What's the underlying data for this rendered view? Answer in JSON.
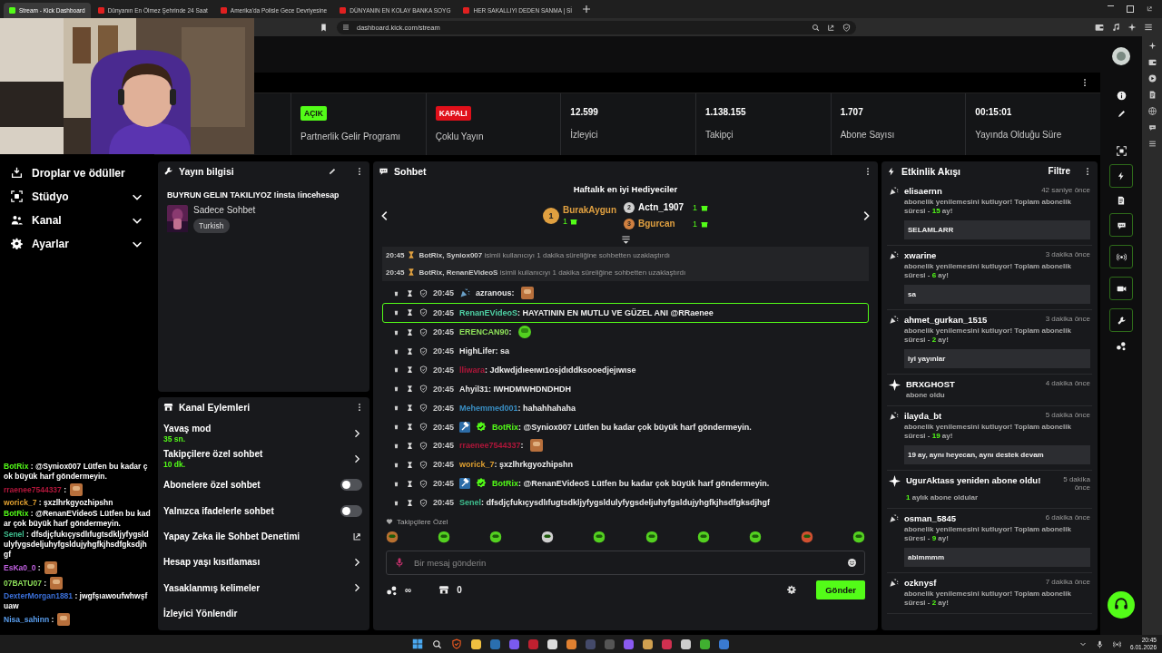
{
  "browser": {
    "tabs": [
      {
        "title": "Stream - Kick Dashboard",
        "selected": true
      },
      {
        "title": "Dünyanın En Ölmez Şehrinde 24 Saat",
        "selected": false
      },
      {
        "title": "Amerika'da Polisle Gece Devriyesine",
        "selected": false
      },
      {
        "title": "DÜNYANIN EN KOLAY BANKA SOYG",
        "selected": false
      },
      {
        "title": "HER SAKALLIYI DEDEN SANMA | Sİ",
        "selected": false
      }
    ],
    "address": "dashboard.kick.com/stream"
  },
  "stats": [
    {
      "kind": "status",
      "value": "AÇIK",
      "on": true,
      "label": "Partnerlik Gelir Programı"
    },
    {
      "kind": "status",
      "value": "KAPALI",
      "on": false,
      "label": "Çoklu Yayın"
    },
    {
      "kind": "number",
      "value": "12.599",
      "label": "İzleyici"
    },
    {
      "kind": "number",
      "value": "1.138.155",
      "label": "Takipçi"
    },
    {
      "kind": "number",
      "value": "1.707",
      "label": "Abone Sayısı"
    },
    {
      "kind": "number",
      "value": "00:15:01",
      "label": "Yayında Olduğu Süre"
    }
  ],
  "sidebar": {
    "items": [
      {
        "label": "Droplar ve ödüller",
        "kind": "link"
      },
      {
        "label": "Stüdyo",
        "kind": "group",
        "expanded": false
      },
      {
        "label": "Kanal",
        "kind": "group",
        "expanded": false
      },
      {
        "label": "Ayarlar",
        "kind": "group",
        "expanded": false
      }
    ]
  },
  "stream_info": {
    "title": "Yayın bilgisi",
    "stream_title": "BUYRUN GELIN TAKILIYOZ !insta !incehesap",
    "category": "Sadece Sohbet",
    "tag": "Turkish"
  },
  "channel_actions": {
    "title": "Kanal Eylemleri",
    "rows": [
      {
        "label": "Yavaş mod",
        "value": "35 sn.",
        "kind": "arrow"
      },
      {
        "label": "Takipçilere özel sohbet",
        "value": "10 dk.",
        "kind": "arrow"
      },
      {
        "label": "Abonelere özel sohbet",
        "kind": "toggle",
        "on": false
      },
      {
        "label": "Yalnızca ifadelerle sohbet",
        "kind": "toggle",
        "on": false
      },
      {
        "label": "Yapay Zeka ile Sohbet Denetimi",
        "kind": "external"
      },
      {
        "label": "Hesap yaşı kısıtlaması",
        "kind": "arrow"
      },
      {
        "label": "Yasaklanmış kelimeler",
        "kind": "arrow"
      },
      {
        "label": "İzleyici Yönlendir",
        "kind": "plain"
      }
    ]
  },
  "chat": {
    "title": "Sohbet",
    "gifters_title": "Haftalık en iyi Hediyeciler",
    "gifters": [
      {
        "rank": "1",
        "name": "BurakAygun",
        "count": "1"
      },
      {
        "rank": "2",
        "name": "Actn_1907",
        "count": "1"
      },
      {
        "rank": "3",
        "name": "Bgurcan",
        "count": "1"
      }
    ],
    "system": [
      {
        "time": "20:45",
        "actor": "BotRix, Syniox007",
        "text": "isimli kullanıcıyı 1 dakika süreliğine sohbetten uzaklaştırdı"
      },
      {
        "time": "20:45",
        "actor": "BotRix, RenanEVideoS",
        "text": "isimli kullanıcıyı 1 dakika süreliğine sohbetten uzaklaştırdı"
      }
    ],
    "messages": [
      {
        "time": "20:45",
        "user": "azranous",
        "color": "#e8e8e8",
        "kind": "badged",
        "text": ":",
        "emote": true,
        "highlighted": false
      },
      {
        "time": "20:45",
        "user": "RenanEVideoS",
        "color": "#4fd1a5",
        "kind": "plain",
        "text": ": HAYATININ EN MUTLU VE GÜZEL ANI @RRaenee",
        "emote": false,
        "highlighted": true
      },
      {
        "time": "20:45",
        "user": "ERENCAN90",
        "color": "#8ee05a",
        "kind": "plain",
        "text": ":",
        "emote": true,
        "highlighted": false
      },
      {
        "time": "20:45",
        "user": "HighLifer",
        "color": "#e8e8e8",
        "kind": "plain",
        "text": ": sa",
        "emote": false,
        "highlighted": false
      },
      {
        "time": "20:45",
        "user": "lliwara",
        "color": "#b0163a",
        "kind": "plain",
        "text": ": Jdkwdjdıeeıwı1osjdıddksooedjejıwıse",
        "emote": false,
        "highlighted": false
      },
      {
        "time": "20:45",
        "user": "Ahyil31",
        "color": "#e8e8e8",
        "kind": "plain",
        "text": ": IWHDMWHDNDHDH",
        "emote": false,
        "highlighted": false
      },
      {
        "time": "20:45",
        "user": "Mehemmed001",
        "color": "#3a8fc4",
        "kind": "plain",
        "text": ": hahahhahaha",
        "emote": false,
        "highlighted": false
      },
      {
        "time": "20:45",
        "user": "BotRix",
        "color": "#53fc18",
        "kind": "bot",
        "text": ": @Syniox007 Lütfen bu kadar çok büyük harf göndermeyin.",
        "emote": false,
        "highlighted": false
      },
      {
        "time": "20:45",
        "user": "rraenee7544337",
        "color": "#b0163a",
        "kind": "plain",
        "text": ":",
        "emote": true,
        "highlighted": false
      },
      {
        "time": "20:45",
        "user": "worick_7",
        "color": "#e0a030",
        "kind": "plain",
        "text": ": şxzlhrkgyozhipshn",
        "emote": false,
        "highlighted": false
      },
      {
        "time": "20:45",
        "user": "BotRix",
        "color": "#53fc18",
        "kind": "bot",
        "text": ": @RenanEVideoS Lütfen bu kadar çok büyük harf göndermeyin.",
        "emote": false,
        "highlighted": false
      },
      {
        "time": "20:45",
        "user": "Senel",
        "color": "#3fbf8f",
        "kind": "plain",
        "text": ": dfsdjçfukıçysdlıfugtsdkljyfygsldulyfygsdeljuhyfgsldujyhgfkjhsdfgksdjhgf",
        "emote": false,
        "highlighted": false
      }
    ],
    "emote_section": "Takipçilere Özel",
    "placeholder": "Bir mesaj gönderin",
    "points": "∞",
    "store_count": "0",
    "send": "Gönder"
  },
  "activity": {
    "title": "Etkinlik Akışı",
    "filter": "Filtre",
    "items": [
      {
        "kind": "resub",
        "user": "elisaernn",
        "time": "42 saniye önce",
        "note": {
          "before": "abonelik yenilemesini kutluyor! Toplam abonelik süresi - ",
          "highlight": "15",
          "after": " ay!"
        },
        "message": "SELAMLARR"
      },
      {
        "kind": "resub",
        "user": "xwarine",
        "time": "3 dakika önce",
        "note": {
          "before": "abonelik yenilemesini kutluyor! Toplam abonelik süresi - ",
          "highlight": "6",
          "after": " ay!"
        },
        "message": "sa"
      },
      {
        "kind": "resub",
        "user": "ahmet_gurkan_1515",
        "time": "3 dakika önce",
        "note": {
          "before": "abonelik yenilemesini kutluyor! Toplam abonelik süresi - ",
          "highlight": "2",
          "after": " ay!"
        },
        "message": "iyi yayınlar"
      },
      {
        "kind": "sub",
        "user": "BRXGHOST",
        "time": "4 dakika önce",
        "note": {
          "before": "abone oldu"
        }
      },
      {
        "kind": "resub",
        "user": "ilayda_bt",
        "time": "5 dakika önce",
        "note": {
          "before": "abonelik yenilemesini kutluyor! Toplam abonelik süresi - ",
          "highlight": "19",
          "after": " ay!"
        },
        "message": "19 ay, aynı heyecan, aynı destek devam"
      },
      {
        "kind": "sub",
        "user": "UgurAktass yeniden abone oldu!",
        "time": "5 dakika önce",
        "note": {
          "highlight": "1",
          "after": " aylık abone oldular"
        }
      },
      {
        "kind": "resub",
        "user": "osman_5845",
        "time": "6 dakika önce",
        "note": {
          "before": "abonelik yenilemesini kutluyor! Toplam abonelik süresi - ",
          "highlight": "9",
          "after": " ay!"
        },
        "message": "abimmmm"
      },
      {
        "kind": "resub",
        "user": "ozknysf",
        "time": "7 dakika önce",
        "note": {
          "before": "abonelik yenilemesini kutluyor! Toplam abonelik süresi - ",
          "highlight": "2",
          "after": " ay!"
        }
      }
    ]
  },
  "overlay_chat": [
    {
      "user": "BotRix",
      "color": "#53fc18",
      "text": ": @Syniox007 Lütfen bu kadar çok büyük harf göndermeyin.",
      "emote": false
    },
    {
      "user": "rraenee7544337",
      "color": "#b0163a",
      "text": ":",
      "emote": true
    },
    {
      "user": "worick_7",
      "color": "#e0a030",
      "text": ": şxzlhrkgyozhipshn",
      "emote": false
    },
    {
      "user": "BotRix",
      "color": "#53fc18",
      "text": ": @RenanEVideoS Lütfen bu kadar çok büyük harf göndermeyin.",
      "emote": false
    },
    {
      "user": "Senel",
      "color": "#3fbf8f",
      "text": ": dfsdjçfukıçysdlıfugtsdkljyfygsldulyfygsdeljuhyfgsldujyhgfkjhsdfgksdjhgf",
      "emote": false
    },
    {
      "user": "EsKa0_0",
      "color": "#c060e0",
      "text": ":",
      "emote": true
    },
    {
      "user": "07BATU07",
      "color": "#8ee05a",
      "text": ":",
      "emote": true
    },
    {
      "user": "DexterMorgan1881",
      "color": "#3a6fd8",
      "text": ": jwgfşıawoufwhwşfuaw",
      "emote": false
    },
    {
      "user": "Nisa_sahinn",
      "color": "#5a9ff0",
      "text": ":",
      "emote": true
    }
  ],
  "taskbar": {
    "time": "20:45",
    "date": "6.01.2026"
  }
}
